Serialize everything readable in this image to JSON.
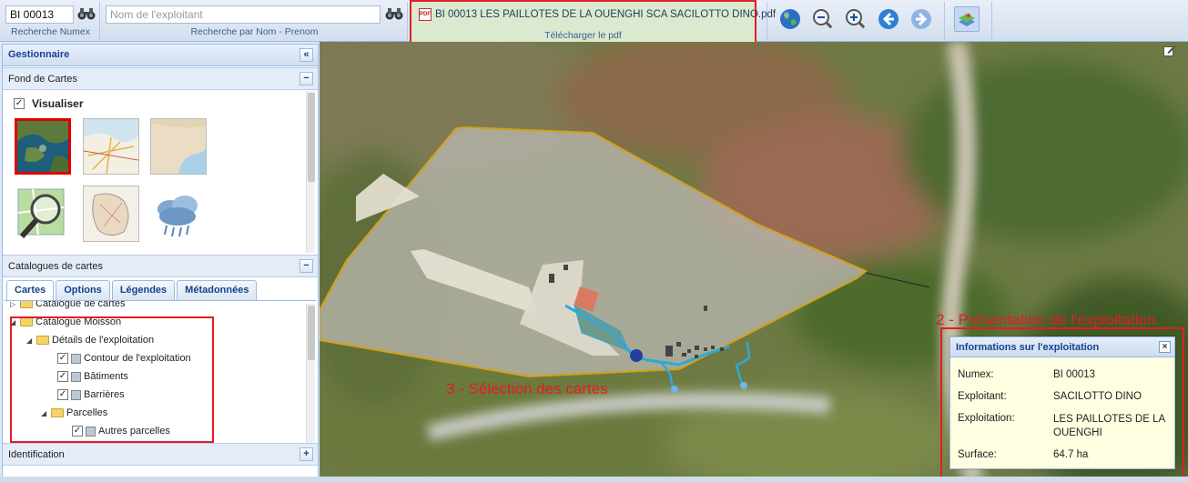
{
  "toolbar": {
    "numex_value": "BI 00013",
    "numex_caption": "Recherche Numex",
    "name_placeholder": "Nom de l'exploitant",
    "name_caption": "Recherche par Nom - Prenom",
    "pdf_filename": "BI 00013 LES PAILLOTES DE LA OUENGHI SCA SACILOTTO DINO.pdf",
    "pdf_caption": "Télécharger le pdf",
    "pdf_icon_text": "PDF",
    "buttons": [
      "globe-icon",
      "zoom-out-icon",
      "zoom-in-icon",
      "back-arrow-icon",
      "forward-arrow-icon",
      "map-layers-icon"
    ]
  },
  "left_panel": {
    "title": "Gestionnaire",
    "collapse_symbol": "«",
    "fond_de_cartes": {
      "title": "Fond de Cartes",
      "toggle": "−",
      "visualiser_label": "Visualiser",
      "visualiser_checked": true,
      "basemaps": [
        "satellite",
        "street-map",
        "coastline-map",
        "osm-search",
        "island-map",
        "clouds"
      ]
    },
    "catalogues": {
      "title": "Catalogues de cartes",
      "toggle": "−",
      "tabs": [
        "Cartes",
        "Options",
        "Légendes",
        "Métadonnées"
      ],
      "active_tab": "Cartes",
      "tree": {
        "catalogue_cartes": "Catalogue de cartes",
        "catalogue_moisson": "Catalogue Moisson",
        "details": "Détails de l'exploitation",
        "contour": "Contour de l'exploitation",
        "batiments": "Bâtiments",
        "barrieres": "Barrières",
        "parcelles": "Parcelles",
        "autres_parcelles": "Autres parcelles"
      }
    },
    "identification": {
      "title": "Identification",
      "toggle": "+"
    }
  },
  "annotations": {
    "selection": "3 - Sélection des cartes",
    "presentation": "2 - Présentation de l'exploitation"
  },
  "info_panel": {
    "title": "Informations sur l'exploitation",
    "close": "×",
    "rows": [
      {
        "label": "Numex:",
        "value": "BI 00013"
      },
      {
        "label": "Exploitant:",
        "value": "SACILOTTO DINO"
      },
      {
        "label": "Exploitation:",
        "value": "LES PAILLOTES DE LA OUENGHI"
      },
      {
        "label": "Surface:",
        "value": "64.7 ha"
      }
    ]
  },
  "colors": {
    "accent": "#15428b",
    "highlight_red": "#e51c23",
    "parcel_outline": "#d4a017",
    "barrier_line": "#2fa8d8"
  }
}
